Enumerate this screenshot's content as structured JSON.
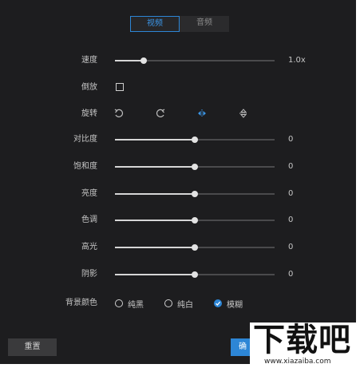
{
  "tabs": [
    {
      "label": "视频",
      "active": true
    },
    {
      "label": "音频",
      "active": false
    }
  ],
  "speed": {
    "label": "速度",
    "value": "1.0x",
    "position": 0.18
  },
  "reverse": {
    "label": "倒放",
    "checked": false
  },
  "rotate": {
    "label": "旋转",
    "icons": [
      "rotate-left-icon",
      "rotate-right-icon",
      "flip-horizontal-icon",
      "flip-vertical-icon"
    ]
  },
  "adjustments": [
    {
      "key": "contrast",
      "label": "对比度",
      "value": "0",
      "position": 0.5
    },
    {
      "key": "saturation",
      "label": "饱和度",
      "value": "0",
      "position": 0.5
    },
    {
      "key": "brightness",
      "label": "亮度",
      "value": "0",
      "position": 0.5
    },
    {
      "key": "hue",
      "label": "色调",
      "value": "0",
      "position": 0.5
    },
    {
      "key": "highlight",
      "label": "高光",
      "value": "0",
      "position": 0.5
    },
    {
      "key": "shadow",
      "label": "阴影",
      "value": "0",
      "position": 0.5
    }
  ],
  "background": {
    "label": "背景颜色",
    "options": [
      {
        "label": "纯黑",
        "selected": false
      },
      {
        "label": "纯白",
        "selected": false
      },
      {
        "label": "模糊",
        "selected": true
      }
    ]
  },
  "buttons": {
    "reset": "重置",
    "ok": "确"
  },
  "watermark": {
    "logo": "下载吧",
    "url": "www.xiazaiba.com"
  },
  "colors": {
    "accent": "#2d86d6",
    "panel": "#1d1d1f"
  }
}
